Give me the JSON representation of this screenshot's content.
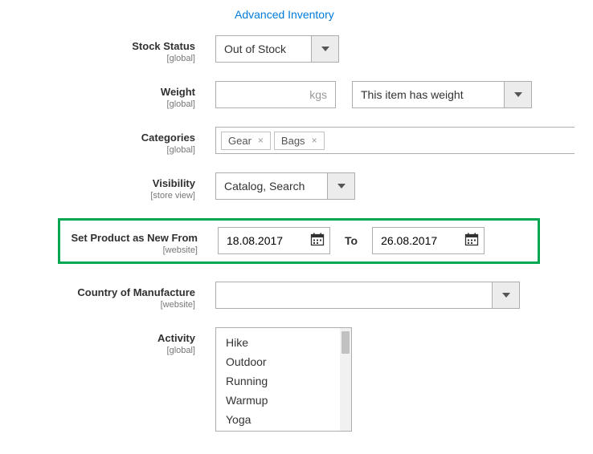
{
  "link": {
    "advanced_inventory": "Advanced Inventory"
  },
  "fields": {
    "stock_status": {
      "label": "Stock Status",
      "scope": "[global]",
      "value": "Out of Stock"
    },
    "weight": {
      "label": "Weight",
      "scope": "[global]",
      "unit": "kgs",
      "value": "",
      "has_weight": "This item has weight"
    },
    "categories": {
      "label": "Categories",
      "scope": "[global]",
      "tags": [
        "Gear",
        "Bags"
      ]
    },
    "visibility": {
      "label": "Visibility",
      "scope": "[store view]",
      "value": "Catalog, Search"
    },
    "new_from": {
      "label": "Set Product as New From",
      "scope": "[website]",
      "from": "18.08.2017",
      "to_label": "To",
      "to": "26.08.2017"
    },
    "country": {
      "label": "Country of Manufacture",
      "scope": "[website]",
      "value": ""
    },
    "activity": {
      "label": "Activity",
      "scope": "[global]",
      "options": [
        "Hike",
        "Outdoor",
        "Running",
        "Warmup",
        "Yoga"
      ]
    }
  }
}
